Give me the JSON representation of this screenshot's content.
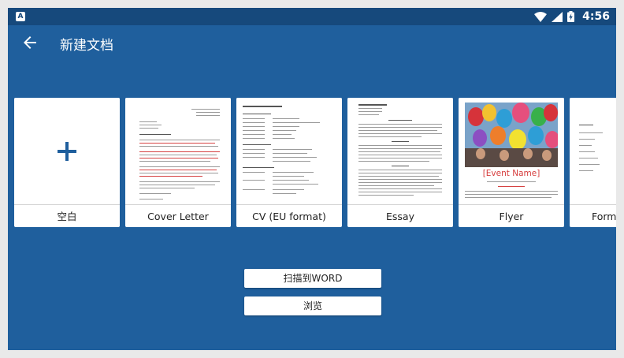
{
  "status_bar": {
    "time": "4:56"
  },
  "toolbar": {
    "title": "新建文档"
  },
  "templates": [
    {
      "label": "空白"
    },
    {
      "label": "Cover Letter"
    },
    {
      "label": "CV (EU format)"
    },
    {
      "label": "Essay"
    },
    {
      "label": "Flyer",
      "event_name": "[Event Name]"
    },
    {
      "label": "Forma"
    }
  ],
  "actions": {
    "scan_label": "扫描到WORD",
    "browse_label": "浏览"
  },
  "colors": {
    "background": "#1f5f9d",
    "status_bar": "#16497c",
    "accent": "#1f5f9d",
    "card": "#ffffff"
  }
}
